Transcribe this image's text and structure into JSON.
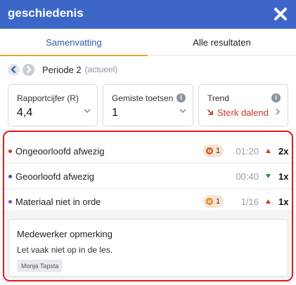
{
  "header": {
    "title": "geschiedenis",
    "close_icon": "close-icon",
    "color": "#3d66c9"
  },
  "tabs": [
    {
      "label": "Samenvatting",
      "active": true
    },
    {
      "label": "Alle resultaten",
      "active": false
    }
  ],
  "period": {
    "label": "Periode 2",
    "status": "(actueel)"
  },
  "cards": {
    "grade": {
      "title": "Rapportcijfer (R)",
      "value": "4,4"
    },
    "missed": {
      "title": "Gemiste toetsen",
      "value": "1"
    },
    "trend": {
      "title": "Trend",
      "value": "Sterk dalend",
      "color": "#c43d2a"
    }
  },
  "rows": [
    {
      "label": "Ongeoorloofd afwezig",
      "dot_color": "#c0392b",
      "badge": "1",
      "badge_icon": "warning-gear-icon",
      "time": "01:20",
      "direction": "up",
      "count": "2x"
    },
    {
      "label": "Geoorloofd afwezig",
      "dot_color": "#2b56b0",
      "badge": "",
      "time": "00:40",
      "direction": "down",
      "count": "1x"
    },
    {
      "label": "Materiaal niet in orde",
      "dot_color": "#9b3dd1",
      "badge": "1",
      "badge_icon": "warning-gear-icon",
      "time": "1/16",
      "direction": "up",
      "count": "1x"
    }
  ],
  "comment": {
    "title": "Medewerker opmerking",
    "text": "Let vaak niet op in de les.",
    "author": "Monja Tapsta"
  },
  "colors": {
    "up_arrow": "#d0392b",
    "down_arrow": "#2e8b3a",
    "badge_bg": "#f6e4d7",
    "highlight_border": "#e51919"
  }
}
